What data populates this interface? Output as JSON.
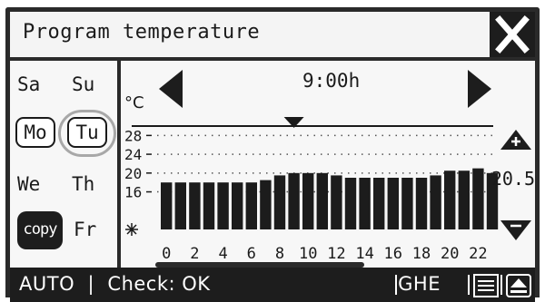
{
  "header": {
    "title": "Program temperature",
    "close_icon": "close-x-icon"
  },
  "days": {
    "sa": "Sa",
    "su": "Su",
    "mo": "Mo",
    "tu": "Tu",
    "we": "We",
    "th": "Th",
    "copy": "copy",
    "fr": "Fr",
    "selected": [
      "Mo",
      "Tu"
    ],
    "highlighted": "Tu"
  },
  "schedule": {
    "time_label": "9:00h",
    "unit": "°C",
    "current_value": "20.5",
    "prev_icon": "left-triangle-icon",
    "next_icon": "right-triangle-icon",
    "increase_icon": "plus-triangle-icon",
    "decrease_icon": "minus-triangle-icon",
    "frost_icon": "snowflake-icon",
    "marker_icon": "down-triangle-marker-icon"
  },
  "chart_data": {
    "type": "bar",
    "y_tick_labels": [
      "28",
      "24",
      "20",
      "16"
    ],
    "x_tick_labels": [
      "0",
      "2",
      "4",
      "6",
      "8",
      "10",
      "12",
      "14",
      "16",
      "18",
      "20",
      "22"
    ],
    "ylim": [
      8,
      30
    ],
    "marker_hour": 9,
    "values": [
      18,
      18,
      18,
      18,
      18,
      18,
      18,
      18.5,
      19.5,
      20,
      20,
      20,
      19.5,
      19,
      19,
      19,
      19,
      19,
      19,
      19.5,
      20.5,
      20.5,
      21,
      20
    ]
  },
  "status": {
    "mode": "AUTO",
    "check_label": "Check: OK",
    "code": "GHE",
    "menu_icon": "menu-lines-icon",
    "eject_icon": "eject-icon"
  }
}
